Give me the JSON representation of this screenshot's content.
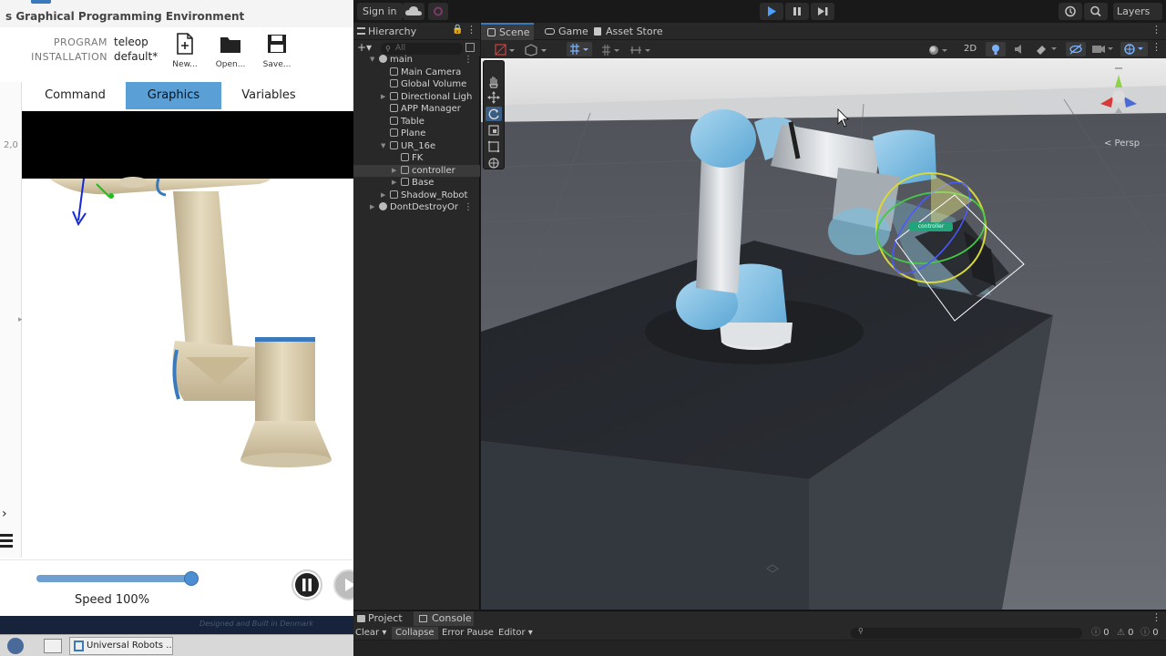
{
  "ur": {
    "window_title": "s Graphical Programming Environment",
    "program_label": "PROGRAM",
    "program_value": "teleop",
    "installation_label": "INSTALLATION",
    "installation_value": "default*",
    "buttons": {
      "new": "New...",
      "open": "Open...",
      "save": "Save..."
    },
    "tabs": [
      "Command",
      "Graphics",
      "Variables"
    ],
    "active_tab": "Graphics",
    "left_value": "2,0",
    "speed_label": "Speed 100%",
    "speed_fraction": 1.0,
    "footer_text": "Designed and Built in Denmark",
    "taskbar_item": "Universal Robots ..."
  },
  "unity": {
    "sign_in": "Sign in",
    "layers": "Layers",
    "play_active": true,
    "hierarchy": {
      "title": "Hierarchy",
      "search_placeholder": "All",
      "items": [
        {
          "label": "main",
          "depth": 0,
          "kind": "scene",
          "expanded": true
        },
        {
          "label": "Main Camera",
          "depth": 1,
          "kind": "object"
        },
        {
          "label": "Global Volume",
          "depth": 1,
          "kind": "object"
        },
        {
          "label": "Directional Ligh",
          "depth": 1,
          "kind": "object",
          "collapsed": true
        },
        {
          "label": "APP Manager",
          "depth": 1,
          "kind": "object"
        },
        {
          "label": "Table",
          "depth": 1,
          "kind": "object"
        },
        {
          "label": "Plane",
          "depth": 1,
          "kind": "object"
        },
        {
          "label": "UR_16e",
          "depth": 1,
          "kind": "object",
          "expanded": true
        },
        {
          "label": "FK",
          "depth": 2,
          "kind": "object"
        },
        {
          "label": "controller",
          "depth": 2,
          "kind": "object",
          "selected": true,
          "collapsed": true
        },
        {
          "label": "Base",
          "depth": 2,
          "kind": "object",
          "collapsed": true
        },
        {
          "label": "Shadow_Robot",
          "depth": 1,
          "kind": "object",
          "collapsed": true
        },
        {
          "label": "DontDestroyOr",
          "depth": 0,
          "kind": "scene",
          "collapsed": true
        }
      ]
    },
    "scene_tabs": [
      "Scene",
      "Game",
      "Asset Store"
    ],
    "active_scene_tab": "Scene",
    "view_2d": "2D",
    "persp_label": "< Persp",
    "gizmo_label": "controller",
    "bottom_tabs": [
      "Project",
      "Console"
    ],
    "active_bottom_tab": "Console",
    "console_buttons": [
      "Clear",
      "Collapse",
      "Error Pause",
      "Editor"
    ],
    "console_counts": [
      "0",
      "0",
      "0"
    ],
    "colors": {
      "play_blue": "#2c4a70",
      "accent": "#3a79bb",
      "ur_tab": "#5aa0d6"
    }
  }
}
